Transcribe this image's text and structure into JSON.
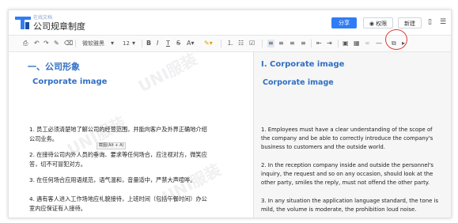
{
  "app": {
    "subtitle": "在线文档",
    "title": "公司规章制度"
  },
  "header": {
    "share_label": "分享",
    "permission_label": "权限",
    "new_label": "新建"
  },
  "toolbar": {
    "font_family": "微软雅黑",
    "font_size": "12",
    "tooltip": "截图(Alt + A)"
  },
  "left_doc": {
    "heading1": "一、公司形象",
    "heading2": "Corporate image",
    "paragraphs": [
      [
        "1. 员工必须清楚地了解公司的经营范围，并能向客户及外界正确地介绍",
        "公司业务。"
      ],
      [
        "2. 在接待公司内外人员的垂询、要求等任何场合，应注视对方，微笑应",
        "答，切不可冒犯对方。"
      ],
      [
        "3. 在任何场合应用语规范，语气温和，音量适中，严禁大声喧哗。"
      ],
      [
        "4. 遇有客人进入工作场地应礼貌接待，上班时间（包括午餐时间）办公",
        "室内应保证有人接待。"
      ]
    ]
  },
  "right_doc": {
    "heading1": "I. Corporate image",
    "heading2": "Corporate image",
    "paragraphs": [
      [
        "1. Employees must have a clear understanding of the scope of",
        "the company and be able to correctly introduce the company's",
        "business to customers and the outside world."
      ],
      [
        "2. In the reception company inside and outside the personnel's",
        "inquiry, the request and so on any occasion, should look at the",
        "other party, smiles the reply, must not offend the other party."
      ],
      [
        "3. In any situation the application language standard, the tone is",
        "mild, the volume is moderate, the prohibition loud noise."
      ]
    ]
  },
  "watermark_text": "UNI服装",
  "colors": {
    "accent": "#2f7df6",
    "heading": "#2f6fc4",
    "highlight_circle": "#e53935"
  }
}
